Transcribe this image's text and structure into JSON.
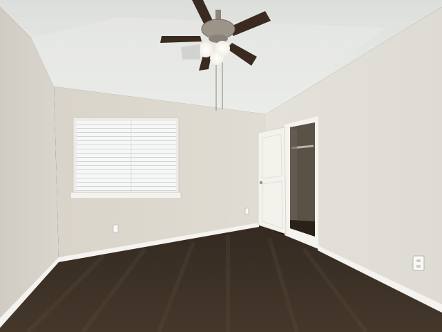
{
  "scene": {
    "subject": "empty-bedroom",
    "colors": {
      "ceiling": "#e9eae6",
      "back_wall": "#dcd8ce",
      "left_wall": "#d6d3cb",
      "right_wall": "#e2dfd8",
      "carpet": "#3d3126",
      "baseboard": "#f4f3ef",
      "door": "#f3f2ec",
      "closet_interior": "#5a5247",
      "window_blinds": "#f7f8f8",
      "fan_blade": "#3a2a20"
    },
    "icons": [
      "ceiling-fan-icon",
      "window-icon",
      "door-icon",
      "electrical-outlet-icon"
    ]
  }
}
